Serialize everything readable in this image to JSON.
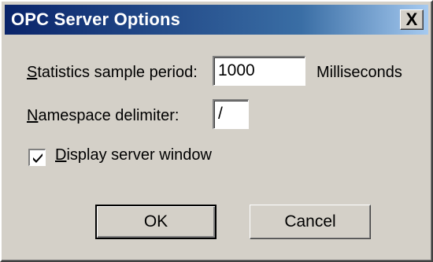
{
  "dialog": {
    "title": "OPC Server Options",
    "close_glyph": "X"
  },
  "fields": {
    "stats_period": {
      "label_accel": "S",
      "label_rest": "tatistics sample period:",
      "value": "1000",
      "unit": "Milliseconds"
    },
    "namespace_delimiter": {
      "label_accel": "N",
      "label_rest": "amespace delimiter:",
      "value": "/"
    },
    "display_server_window": {
      "label_accel": "D",
      "label_rest": "isplay server window",
      "checked": true
    }
  },
  "buttons": {
    "ok_label": "OK",
    "cancel_label": "Cancel"
  },
  "colors": {
    "titlebar_start": "#0a246a",
    "titlebar_end": "#a6caf0",
    "face": "#d4d0c8"
  }
}
